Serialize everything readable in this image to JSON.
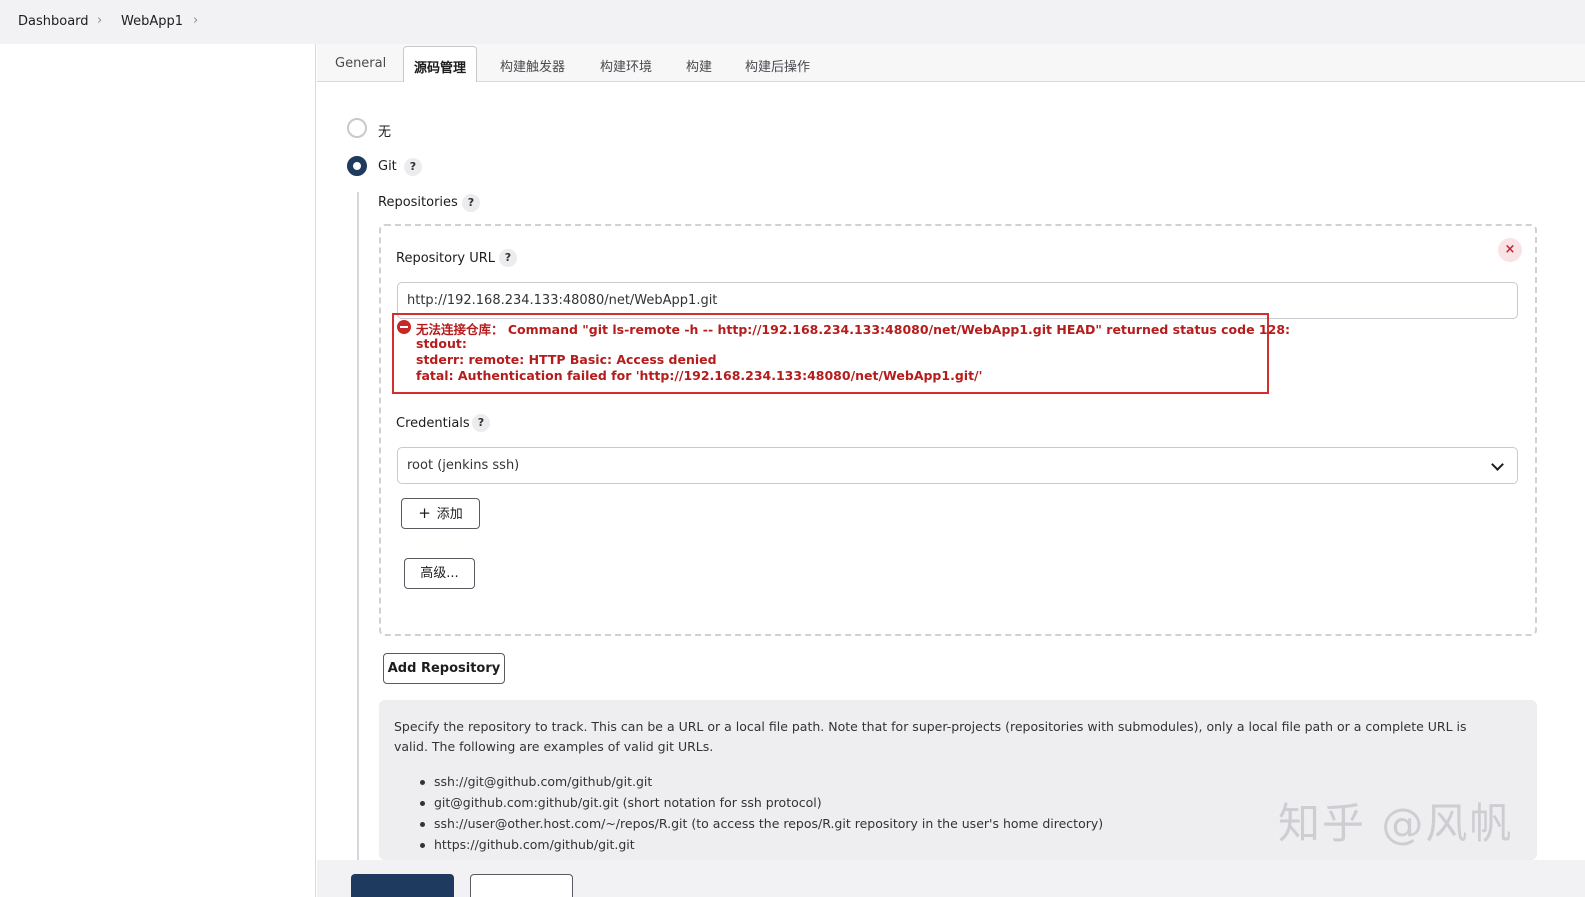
{
  "breadcrumb": {
    "items": [
      "Dashboard",
      "WebApp1"
    ]
  },
  "tabs": [
    "General",
    "源码管理",
    "构建触发器",
    "构建环境",
    "构建",
    "构建后操作"
  ],
  "scm": {
    "none_label": "无",
    "git_label": "Git",
    "selected": "Git",
    "repositories_label": "Repositories",
    "repo_url_label": "Repository URL",
    "repo_url_value": "http://192.168.234.133:48080/net/WebApp1.git",
    "error_lines": [
      "无法连接仓库：  Command \"git ls-remote -h -- http://192.168.234.133:48080/net/WebApp1.git HEAD\" returned status code 128:",
      "stdout:",
      "stderr: remote: HTTP Basic: Access denied",
      "fatal: Authentication failed for 'http://192.168.234.133:48080/net/WebApp1.git/'"
    ],
    "credentials_label": "Credentials",
    "credentials_value": "root (jenkins ssh)",
    "add_button": "添加",
    "advanced_button": "高级...",
    "add_repository_button": "Add Repository",
    "help_icon": "?",
    "close_icon": "×"
  },
  "help": {
    "paragraph": "Specify the repository to track. This can be a URL or a local file path. Note that for super-projects (repositories with submodules), only a local file path or a complete URL is valid. The following are examples of valid git URLs.",
    "examples": [
      "ssh://git@github.com/github/git.git",
      "git@github.com:github/git.git (short notation for ssh protocol)",
      "ssh://user@other.host.com/~/repos/R.git (to access the repos/R.git repository in the user's home directory)",
      "https://github.com/github/git.git"
    ]
  },
  "watermark": "知乎 @风帆",
  "colors": {
    "accent": "#1e3a5f",
    "error": "#d32f2f",
    "panel": "#eeeef0"
  }
}
